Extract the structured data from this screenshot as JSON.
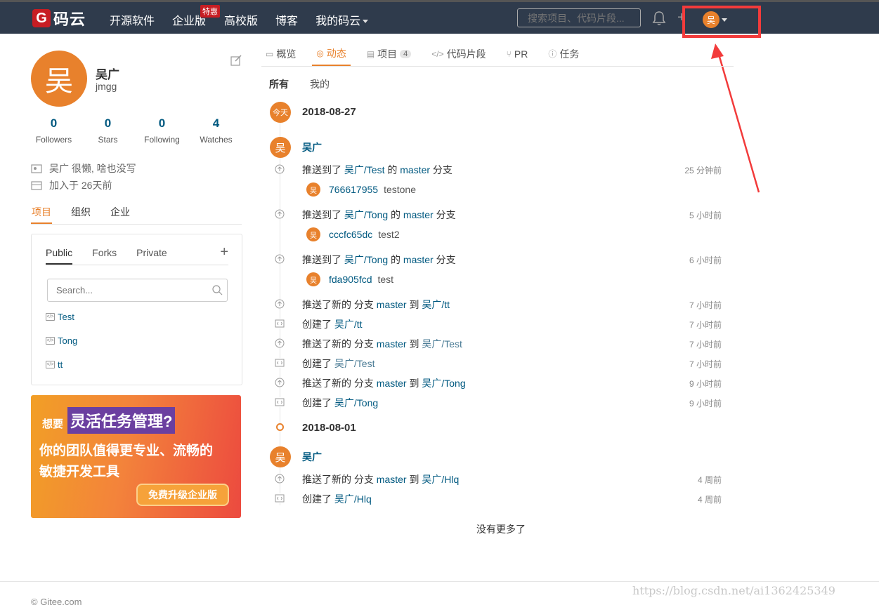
{
  "topbar": {
    "logo_text": "码云",
    "nav": [
      "开源软件",
      "企业版",
      "高校版",
      "博客",
      "我的码云"
    ],
    "hot_badge": "特惠",
    "search_placeholder": "搜索项目、代码片段...",
    "user_initial": "吴"
  },
  "profile": {
    "avatar": "吴",
    "name": "吴广",
    "login": "jmgg",
    "stats": [
      {
        "num": "0",
        "label": "Followers"
      },
      {
        "num": "0",
        "label": "Stars"
      },
      {
        "num": "0",
        "label": "Following"
      },
      {
        "num": "4",
        "label": "Watches"
      }
    ],
    "bio": "吴广 很懒, 啥也没写",
    "joined": "加入于 26天前"
  },
  "left_tabs": [
    "项目",
    "组织",
    "企业"
  ],
  "projects": {
    "tabs": [
      "Public",
      "Forks",
      "Private"
    ],
    "search_placeholder": "Search...",
    "items": [
      "Test",
      "Tong",
      "tt"
    ]
  },
  "banner": {
    "want": "想要",
    "headline": "灵活任务管理?",
    "line2": "你的团队值得更专业、流畅的",
    "line3": "敏捷开发工具",
    "button": "免费升级企业版"
  },
  "main_tabs": [
    {
      "label": "概览",
      "icon": "overview-icon"
    },
    {
      "label": "动态",
      "icon": "activity-icon"
    },
    {
      "label": "项目",
      "icon": "project-icon",
      "count": "4"
    },
    {
      "label": "代码片段",
      "icon": "code-icon"
    },
    {
      "label": "PR",
      "icon": "pr-icon"
    },
    {
      "label": "任务",
      "icon": "issue-icon"
    }
  ],
  "sub_tabs": [
    "所有",
    "我的"
  ],
  "timeline": {
    "today_label": "今天",
    "date1": "2018-08-27",
    "date2": "2018-08-01",
    "user": "吴广",
    "user_initial": "吴",
    "events": [
      {
        "pre": "推送到了 ",
        "repo": "吴广/Test",
        "mid": " 的 ",
        "branch": "master",
        "post": " 分支",
        "time": "25 分钟前",
        "sha": "766617955",
        "msg": "testone"
      },
      {
        "pre": "推送到了 ",
        "repo": "吴广/Tong",
        "mid": " 的 ",
        "branch": "master",
        "post": " 分支",
        "time": "5 小时前",
        "sha": "cccfc65dc",
        "msg": "test2"
      },
      {
        "pre": "推送到了 ",
        "repo": "吴广/Tong",
        "mid": " 的 ",
        "branch": "master",
        "post": " 分支",
        "time": "6 小时前",
        "sha": "fda905fcd",
        "msg": "test"
      },
      {
        "pre": "推送了新的 分支 ",
        "branch": "master",
        "mid": " 到 ",
        "repo": "吴广/tt",
        "time": "7 小时前"
      },
      {
        "pre": "创建了 ",
        "repo": "吴广/tt",
        "time": "7 小时前"
      },
      {
        "pre": "推送了新的 分支 ",
        "branch": "master",
        "mid": " 到 ",
        "repo": "吴广/Test",
        "time": "7 小时前"
      },
      {
        "pre": "创建了 ",
        "repo": "吴广/Test",
        "time": "7 小时前"
      },
      {
        "pre": "推送了新的 分支 ",
        "branch": "master",
        "mid": " 到 ",
        "repo": "吴广/Tong",
        "time": "9 小时前"
      },
      {
        "pre": "创建了 ",
        "repo": "吴广/Tong",
        "time": "9 小时前"
      },
      {
        "pre": "推送了新的 分支 ",
        "branch": "master",
        "mid": " 到 ",
        "repo": "吴广/Hlq",
        "time": "4 周前"
      },
      {
        "pre": "创建了 ",
        "repo": "吴广/Hlq",
        "time": "4 周前"
      }
    ],
    "no_more": "没有更多了"
  },
  "footer": "© Gitee.com",
  "watermark": "https://blog.csdn.net/ai1362425349",
  "colors": {
    "accent": "#e8812c",
    "link": "#005980",
    "topbar": "#2f3b4c",
    "annotation": "#f23b3b"
  }
}
